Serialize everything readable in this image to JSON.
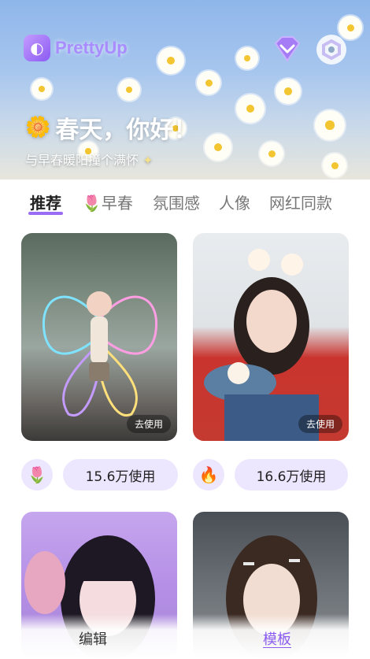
{
  "app": {
    "name": "PrettyUp"
  },
  "banner": {
    "headline": "春天，你好！",
    "subline": "与早春暖阳撞个满怀"
  },
  "tabs": [
    {
      "label": "推荐",
      "active": true
    },
    {
      "label": "早春",
      "icon": "tulip-icon"
    },
    {
      "label": "氛围感"
    },
    {
      "label": "人像"
    },
    {
      "label": "网红同款"
    }
  ],
  "templates": [
    {
      "use_label": "去使用",
      "stat_icon": "tulip-icon",
      "usage": "15.6万使用"
    },
    {
      "use_label": "去使用",
      "stat_icon": "fire-icon",
      "usage": "16.6万使用"
    },
    {},
    {}
  ],
  "bottom_nav": [
    {
      "label": "编辑"
    },
    {
      "label": "模板",
      "active": true
    }
  ],
  "colors": {
    "accent": "#9a6cf4",
    "pill_bg": "#ece6ff"
  }
}
